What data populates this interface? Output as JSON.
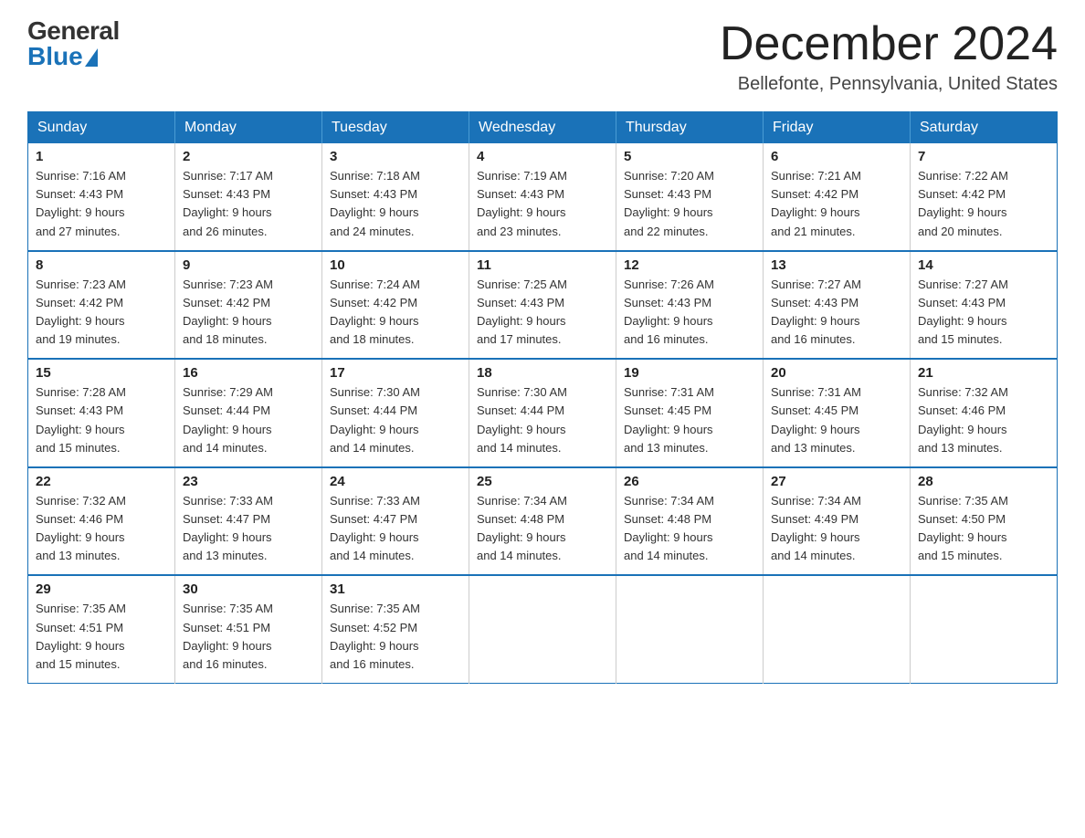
{
  "logo": {
    "general": "General",
    "blue": "Blue"
  },
  "title": "December 2024",
  "location": "Bellefonte, Pennsylvania, United States",
  "days_of_week": [
    "Sunday",
    "Monday",
    "Tuesday",
    "Wednesday",
    "Thursday",
    "Friday",
    "Saturday"
  ],
  "weeks": [
    [
      {
        "day": "1",
        "sunrise": "7:16 AM",
        "sunset": "4:43 PM",
        "daylight": "9 hours and 27 minutes."
      },
      {
        "day": "2",
        "sunrise": "7:17 AM",
        "sunset": "4:43 PM",
        "daylight": "9 hours and 26 minutes."
      },
      {
        "day": "3",
        "sunrise": "7:18 AM",
        "sunset": "4:43 PM",
        "daylight": "9 hours and 24 minutes."
      },
      {
        "day": "4",
        "sunrise": "7:19 AM",
        "sunset": "4:43 PM",
        "daylight": "9 hours and 23 minutes."
      },
      {
        "day": "5",
        "sunrise": "7:20 AM",
        "sunset": "4:43 PM",
        "daylight": "9 hours and 22 minutes."
      },
      {
        "day": "6",
        "sunrise": "7:21 AM",
        "sunset": "4:42 PM",
        "daylight": "9 hours and 21 minutes."
      },
      {
        "day": "7",
        "sunrise": "7:22 AM",
        "sunset": "4:42 PM",
        "daylight": "9 hours and 20 minutes."
      }
    ],
    [
      {
        "day": "8",
        "sunrise": "7:23 AM",
        "sunset": "4:42 PM",
        "daylight": "9 hours and 19 minutes."
      },
      {
        "day": "9",
        "sunrise": "7:23 AM",
        "sunset": "4:42 PM",
        "daylight": "9 hours and 18 minutes."
      },
      {
        "day": "10",
        "sunrise": "7:24 AM",
        "sunset": "4:42 PM",
        "daylight": "9 hours and 18 minutes."
      },
      {
        "day": "11",
        "sunrise": "7:25 AM",
        "sunset": "4:43 PM",
        "daylight": "9 hours and 17 minutes."
      },
      {
        "day": "12",
        "sunrise": "7:26 AM",
        "sunset": "4:43 PM",
        "daylight": "9 hours and 16 minutes."
      },
      {
        "day": "13",
        "sunrise": "7:27 AM",
        "sunset": "4:43 PM",
        "daylight": "9 hours and 16 minutes."
      },
      {
        "day": "14",
        "sunrise": "7:27 AM",
        "sunset": "4:43 PM",
        "daylight": "9 hours and 15 minutes."
      }
    ],
    [
      {
        "day": "15",
        "sunrise": "7:28 AM",
        "sunset": "4:43 PM",
        "daylight": "9 hours and 15 minutes."
      },
      {
        "day": "16",
        "sunrise": "7:29 AM",
        "sunset": "4:44 PM",
        "daylight": "9 hours and 14 minutes."
      },
      {
        "day": "17",
        "sunrise": "7:30 AM",
        "sunset": "4:44 PM",
        "daylight": "9 hours and 14 minutes."
      },
      {
        "day": "18",
        "sunrise": "7:30 AM",
        "sunset": "4:44 PM",
        "daylight": "9 hours and 14 minutes."
      },
      {
        "day": "19",
        "sunrise": "7:31 AM",
        "sunset": "4:45 PM",
        "daylight": "9 hours and 13 minutes."
      },
      {
        "day": "20",
        "sunrise": "7:31 AM",
        "sunset": "4:45 PM",
        "daylight": "9 hours and 13 minutes."
      },
      {
        "day": "21",
        "sunrise": "7:32 AM",
        "sunset": "4:46 PM",
        "daylight": "9 hours and 13 minutes."
      }
    ],
    [
      {
        "day": "22",
        "sunrise": "7:32 AM",
        "sunset": "4:46 PM",
        "daylight": "9 hours and 13 minutes."
      },
      {
        "day": "23",
        "sunrise": "7:33 AM",
        "sunset": "4:47 PM",
        "daylight": "9 hours and 13 minutes."
      },
      {
        "day": "24",
        "sunrise": "7:33 AM",
        "sunset": "4:47 PM",
        "daylight": "9 hours and 14 minutes."
      },
      {
        "day": "25",
        "sunrise": "7:34 AM",
        "sunset": "4:48 PM",
        "daylight": "9 hours and 14 minutes."
      },
      {
        "day": "26",
        "sunrise": "7:34 AM",
        "sunset": "4:48 PM",
        "daylight": "9 hours and 14 minutes."
      },
      {
        "day": "27",
        "sunrise": "7:34 AM",
        "sunset": "4:49 PM",
        "daylight": "9 hours and 14 minutes."
      },
      {
        "day": "28",
        "sunrise": "7:35 AM",
        "sunset": "4:50 PM",
        "daylight": "9 hours and 15 minutes."
      }
    ],
    [
      {
        "day": "29",
        "sunrise": "7:35 AM",
        "sunset": "4:51 PM",
        "daylight": "9 hours and 15 minutes."
      },
      {
        "day": "30",
        "sunrise": "7:35 AM",
        "sunset": "4:51 PM",
        "daylight": "9 hours and 16 minutes."
      },
      {
        "day": "31",
        "sunrise": "7:35 AM",
        "sunset": "4:52 PM",
        "daylight": "9 hours and 16 minutes."
      },
      null,
      null,
      null,
      null
    ]
  ],
  "labels": {
    "sunrise": "Sunrise:",
    "sunset": "Sunset:",
    "daylight": "Daylight:"
  }
}
